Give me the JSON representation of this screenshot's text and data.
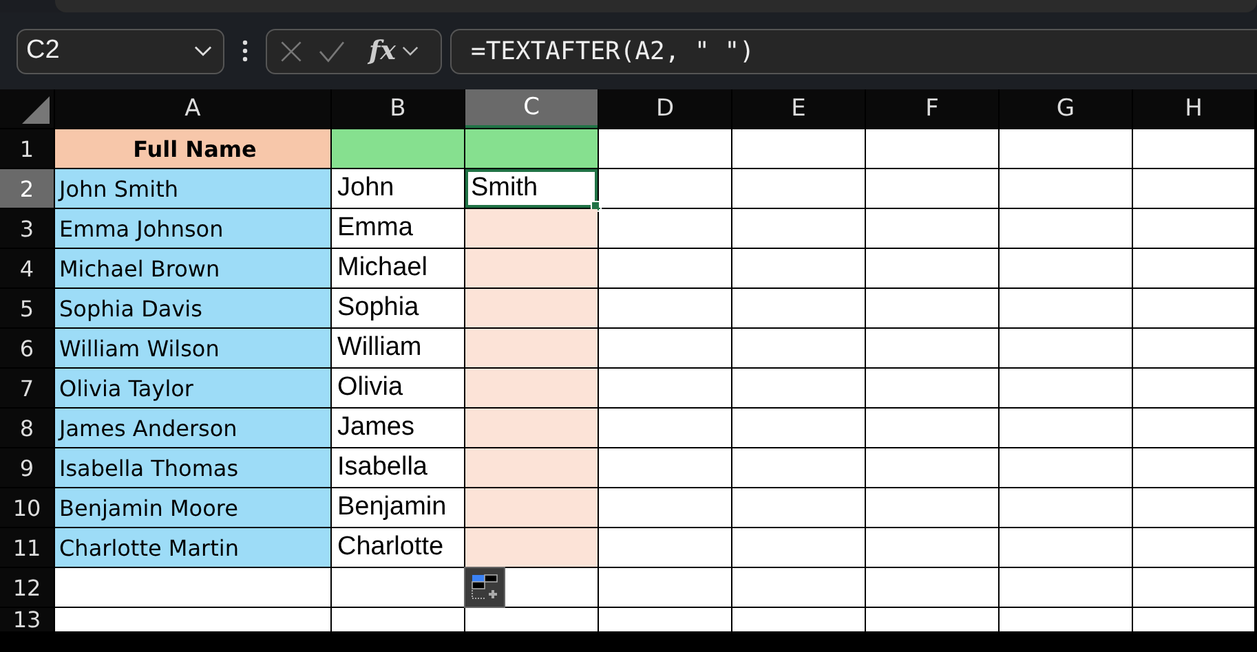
{
  "name_box": {
    "value": "C2"
  },
  "formula_bar": {
    "function_label": "fx",
    "value": "=TEXTAFTER(A2, \" \")"
  },
  "columns": [
    {
      "label": "A",
      "selected": false
    },
    {
      "label": "B",
      "selected": false
    },
    {
      "label": "C",
      "selected": true
    },
    {
      "label": "D",
      "selected": false
    },
    {
      "label": "E",
      "selected": false
    },
    {
      "label": "F",
      "selected": false
    },
    {
      "label": "G",
      "selected": false
    },
    {
      "label": "H",
      "selected": false
    }
  ],
  "rows": [
    {
      "label": "1",
      "selected": false,
      "cells": [
        {
          "text": "Full Name",
          "bold": true,
          "color": "#f7c7aa",
          "selected": false
        },
        {
          "color": "#86e08f",
          "selected": false
        },
        {
          "color": "#86e08f",
          "selected": false
        }
      ]
    },
    {
      "label": "2",
      "selected": true,
      "cells": [
        {
          "text": "John Smith",
          "color": "#9ddcf7",
          "selected": false
        },
        {
          "text": "John",
          "selected": false
        },
        {
          "text": "Smith",
          "selected": true
        }
      ]
    },
    {
      "label": "3",
      "selected": false,
      "cells": [
        {
          "text": "Emma Johnson",
          "color": "#9ddcf7",
          "selected": false
        },
        {
          "text": "Emma",
          "selected": false
        },
        {
          "color": "#fce3d7",
          "selected": false
        }
      ]
    },
    {
      "label": "4",
      "selected": false,
      "cells": [
        {
          "text": "Michael Brown",
          "color": "#9ddcf7",
          "selected": false
        },
        {
          "text": "Michael",
          "selected": false
        },
        {
          "color": "#fce3d7",
          "selected": false
        }
      ]
    },
    {
      "label": "5",
      "selected": false,
      "cells": [
        {
          "text": "Sophia Davis",
          "color": "#9ddcf7",
          "selected": false
        },
        {
          "text": "Sophia",
          "selected": false
        },
        {
          "color": "#fce3d7",
          "selected": false
        }
      ]
    },
    {
      "label": "6",
      "selected": false,
      "cells": [
        {
          "text": "William Wilson",
          "color": "#9ddcf7",
          "selected": false
        },
        {
          "text": "William",
          "selected": false
        },
        {
          "color": "#fce3d7",
          "selected": false
        }
      ]
    },
    {
      "label": "7",
      "selected": false,
      "cells": [
        {
          "text": "Olivia Taylor",
          "color": "#9ddcf7",
          "selected": false
        },
        {
          "text": "Olivia",
          "selected": false
        },
        {
          "color": "#fce3d7",
          "selected": false
        }
      ]
    },
    {
      "label": "8",
      "selected": false,
      "cells": [
        {
          "text": "James Anderson",
          "color": "#9ddcf7",
          "selected": false
        },
        {
          "text": "James",
          "selected": false
        },
        {
          "color": "#fce3d7",
          "selected": false
        }
      ]
    },
    {
      "label": "9",
      "selected": false,
      "cells": [
        {
          "text": "Isabella Thomas",
          "color": "#9ddcf7",
          "selected": false
        },
        {
          "text": "Isabella",
          "selected": false
        },
        {
          "color": "#fce3d7",
          "selected": false
        }
      ]
    },
    {
      "label": "10",
      "selected": false,
      "cells": [
        {
          "text": "Benjamin Moore",
          "color": "#9ddcf7",
          "selected": false
        },
        {
          "text": "Benjamin",
          "selected": false
        },
        {
          "color": "#fce3d7",
          "selected": false
        }
      ]
    },
    {
      "label": "11",
      "selected": false,
      "cells": [
        {
          "text": "Charlotte Martin",
          "color": "#9ddcf7",
          "selected": false
        },
        {
          "text": "Charlotte",
          "selected": false
        },
        {
          "color": "#fce3d7",
          "selected": false
        }
      ]
    },
    {
      "label": "12",
      "selected": false
    },
    {
      "label": "13",
      "selected": false
    }
  ]
}
